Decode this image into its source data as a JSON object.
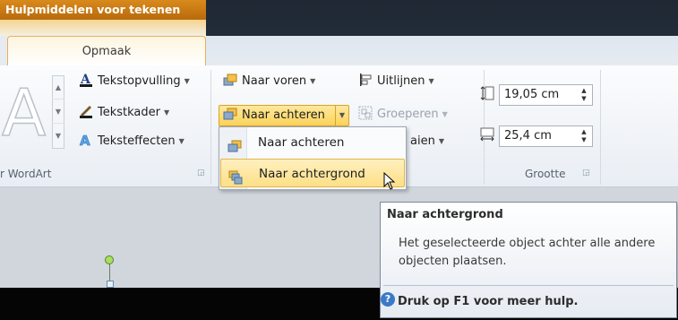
{
  "context_tab": {
    "title": "Hulpmiddelen voor tekenen"
  },
  "tabs": [
    {
      "label": "Opmaak",
      "active": true
    }
  ],
  "ribbon": {
    "wordart_group": {
      "label": "r WordArt",
      "tekstopvulling": "Tekstopvulling",
      "tekstkader": "Tekstkader",
      "teksteffecten": "Teksteffecten"
    },
    "arrange_group": {
      "naar_voren": "Naar voren",
      "naar_achteren": "Naar achteren",
      "uitlijnen": "Uitlijnen",
      "groeperen": "Groeperen",
      "draaien_partial": "aien"
    },
    "size_group": {
      "label": "Grootte",
      "height_value": "19,05 cm",
      "width_value": "25,4 cm"
    }
  },
  "dropdown_menu": {
    "items": [
      {
        "label": "Naar achteren",
        "highlighted": false
      },
      {
        "label": "Naar achtergrond",
        "highlighted": true
      }
    ]
  },
  "tooltip": {
    "title": "Naar achtergrond",
    "body": "Het geselecteerde object achter alle andere objecten plaatsen.",
    "help": "Druk op F1 voor meer hulp."
  },
  "colors": {
    "context_orange": "#c87a12",
    "highlight_yellow": "#fbd35c",
    "help_blue": "#3b79c9"
  }
}
